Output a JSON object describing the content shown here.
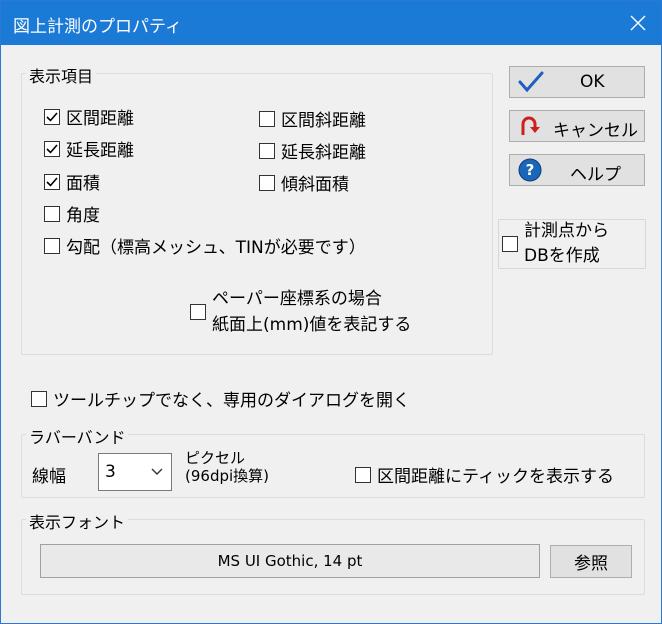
{
  "window": {
    "title": "図上計測のプロパティ"
  },
  "display_items": {
    "group_title": "表示項目",
    "items": [
      {
        "label": "区間距離",
        "checked": true
      },
      {
        "label": "延長距離",
        "checked": true
      },
      {
        "label": "面積",
        "checked": true
      },
      {
        "label": "角度",
        "checked": false
      },
      {
        "label": "勾配（標高メッシュ、TINが必要です）",
        "checked": false
      },
      {
        "label": "区間斜距離",
        "checked": false
      },
      {
        "label": "延長斜距離",
        "checked": false
      },
      {
        "label": "傾斜面積",
        "checked": false
      }
    ],
    "paper_coord": {
      "line1": "ペーパー座標系の場合",
      "line2": "紙面上(mm)値を表記する",
      "checked": false
    }
  },
  "buttons": {
    "ok": "OK",
    "cancel": "キャンセル",
    "help": "ヘルプ"
  },
  "create_db": {
    "line1": "計測点から",
    "line2": "DBを作成",
    "checked": false
  },
  "tooltip_option": {
    "label": "ツールチップでなく、専用のダイアログを開く",
    "checked": false
  },
  "rubberband": {
    "group_title": "ラバーバンド",
    "width_label": "線幅",
    "width_value": "3",
    "unit_line1": "ピクセル",
    "unit_line2": "(96dpi換算)",
    "tick_label": "区間距離にティックを表示する",
    "tick_checked": false
  },
  "display_font": {
    "group_title": "表示フォント",
    "value": "MS UI Gothic, 14 pt",
    "browse": "参照"
  },
  "colors": {
    "titlebar": "#1c7ad7",
    "ok_check": "#1f5fbf",
    "cancel_arrow": "#cc1f1f",
    "help_icon": "#1a66b8"
  }
}
